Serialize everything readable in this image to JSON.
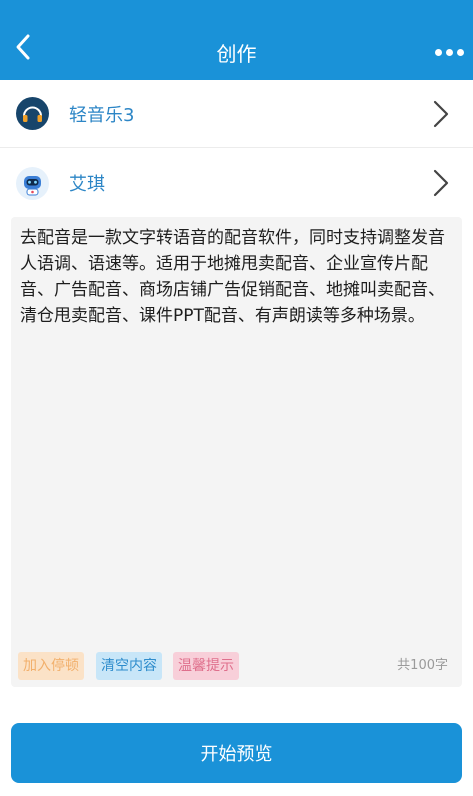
{
  "header": {
    "title": "创作",
    "back_icon": "chevron-left-icon",
    "more_icon": "more-horizontal-icon"
  },
  "music_row": {
    "label": "轻音乐3",
    "icon": "headphones-icon"
  },
  "voice_row": {
    "label": "艾琪",
    "icon": "robot-avatar-icon"
  },
  "editor": {
    "content": "去配音是一款文字转语音的配音软件，同时支持调整发音人语调、语速等。适用于地摊甩卖配音、企业宣传片配音、广告配音、商场店铺广告促销配音、地摊叫卖配音、清仓甩卖配音、课件PPT配音、有声朗读等多种场景。",
    "insert_pause_label": "加入停顿",
    "clear_label": "清空内容",
    "tips_label": "温馨提示",
    "char_count": "共100字"
  },
  "footer": {
    "start_preview_label": "开始预览"
  },
  "colors": {
    "primary": "#1a92d8",
    "link": "#2d86c6",
    "editor_bg": "#f4f4f4"
  }
}
